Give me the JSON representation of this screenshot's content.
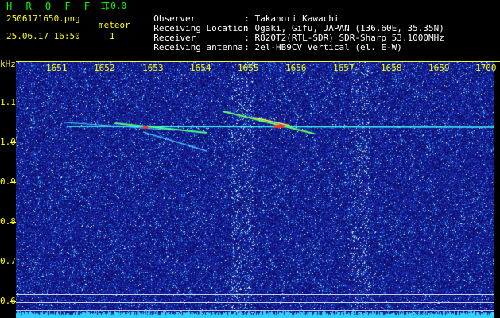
{
  "header": {
    "app_title": "H R O F F T",
    "app_version": "1.0.0",
    "filename": "2506171650.png",
    "datetime": "25.06.17 16:50",
    "detection_label": "meteor",
    "detection_count": "1",
    "info": [
      {
        "label": "Observer",
        "value": ": Takanori Kawachi"
      },
      {
        "label": "Receiving Location",
        "value": ": Ogaki, Gifu, JAPAN (136.60E, 35.35N)"
      },
      {
        "label": "Receiver",
        "value": ": R820T2(RTL-SDR) SDR-Sharp 53.1000MHz"
      },
      {
        "label": "Receiving antenna",
        "value": ": 2el-HB9CV Vertical (el. E-W)"
      }
    ]
  },
  "axes": {
    "y_unit": "kHz",
    "x_ticks": [
      "1651",
      "1652",
      "1653",
      "1654",
      "1655",
      "1656",
      "1657",
      "1658",
      "1659",
      "1700"
    ],
    "y_ticks": [
      "1.1",
      "1.0",
      "0.9",
      "0.8",
      "0.7",
      "0.6"
    ]
  },
  "colors": {
    "label_yellow": "#ffff00",
    "title_green": "#00ff00",
    "background_blue": "#10107a",
    "carrier_cyan": "#40ffff",
    "meteor_red": "#ff3030"
  }
}
